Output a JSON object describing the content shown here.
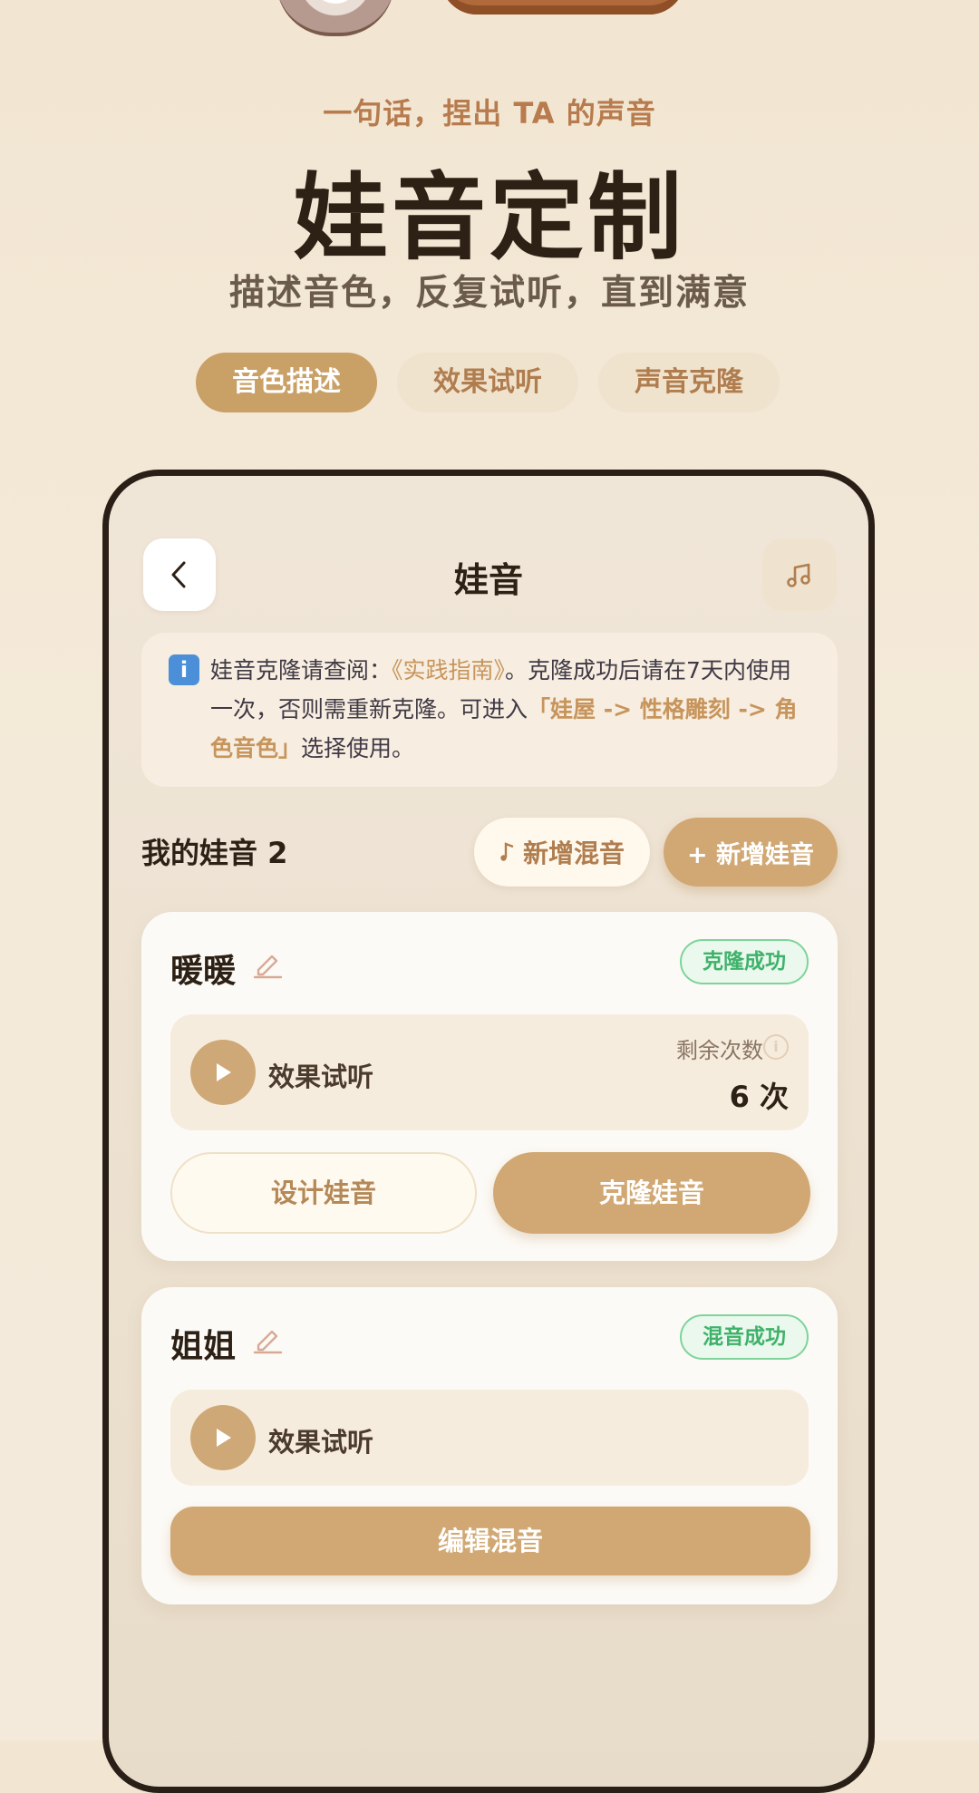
{
  "header": {
    "subtitle": "一句话，捏出 TA 的声音",
    "title": "娃音定制",
    "description": "描述音色，反复试听，直到满意"
  },
  "tabs": [
    {
      "label": "音色描述",
      "active": true
    },
    {
      "label": "效果试听",
      "active": false
    },
    {
      "label": "声音克隆",
      "active": false
    }
  ],
  "phone": {
    "nav_title": "娃音",
    "notice": {
      "text_1": "娃音克隆请查阅：",
      "link": "《实践指南》",
      "text_2": "。克隆成功后请在7天内使用一次，否则需重新克隆。可进入",
      "path": "「娃屋 -> 性格雕刻 -> 角色音色」",
      "text_3": "选择使用。"
    },
    "my_voices_title": "我的娃音 2",
    "add_mix_label": "新增混音",
    "add_voice_label": "+ 新增娃音",
    "cards": [
      {
        "name": "暖暖",
        "status": "克隆成功",
        "listen_label": "效果试听",
        "remain_label": "剩余次数",
        "remain_count": "6 次",
        "design_button": "设计娃音",
        "clone_button": "克隆娃音"
      },
      {
        "name": "姐姐",
        "status": "混音成功",
        "listen_label": "效果试听",
        "edit_mix_button": "编辑混音"
      }
    ]
  },
  "colors": {
    "accent": "#d1a873",
    "success": "#3fb26a",
    "text_dark": "#2d2116"
  }
}
